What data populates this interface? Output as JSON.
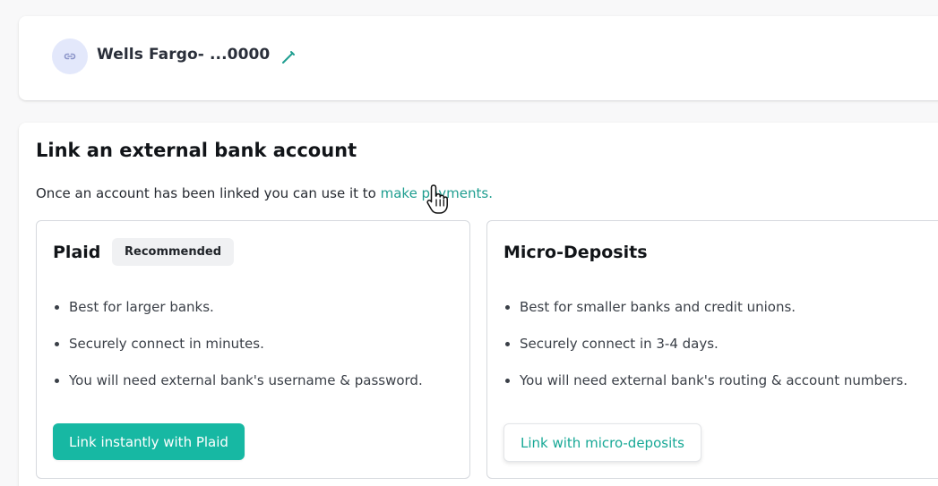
{
  "account": {
    "name": "Wells Fargo- ...0000",
    "icon": "link-icon",
    "edit_icon": "pencil-icon"
  },
  "link_section": {
    "title": "Link an external bank account",
    "description": "Once an account has been linked you can use it to ",
    "link_text": "make payments."
  },
  "options": {
    "plaid": {
      "title": "Plaid",
      "badge": "Recommended",
      "bullets": [
        "Best for larger banks.",
        "Securely connect in minutes.",
        "You will need external bank's username & password."
      ],
      "button": "Link instantly with Plaid"
    },
    "micro": {
      "title": "Micro-Deposits",
      "bullets": [
        "Best for smaller banks and credit unions.",
        "Securely connect in 3-4 days.",
        "You will need external bank's routing & account numbers."
      ],
      "button": "Link with micro-deposits"
    }
  },
  "colors": {
    "accent": "#17b8a3",
    "link": "#1f9e90",
    "icon_bg": "#e3e8fb"
  },
  "cursor_icon": "hand-pointer-icon"
}
